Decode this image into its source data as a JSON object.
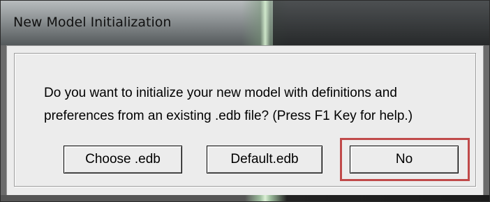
{
  "window": {
    "title": "New Model Initialization"
  },
  "message": {
    "line1": "Do you want to initialize your new model with definitions and",
    "line2": "preferences from an existing .edb file? (Press F1 Key for help.)"
  },
  "buttons": {
    "choose_label": "Choose .edb",
    "default_label": "Default.edb",
    "no_label": "No"
  },
  "colors": {
    "highlight": "#c04a4a",
    "dialog_bg": "#ececec"
  }
}
